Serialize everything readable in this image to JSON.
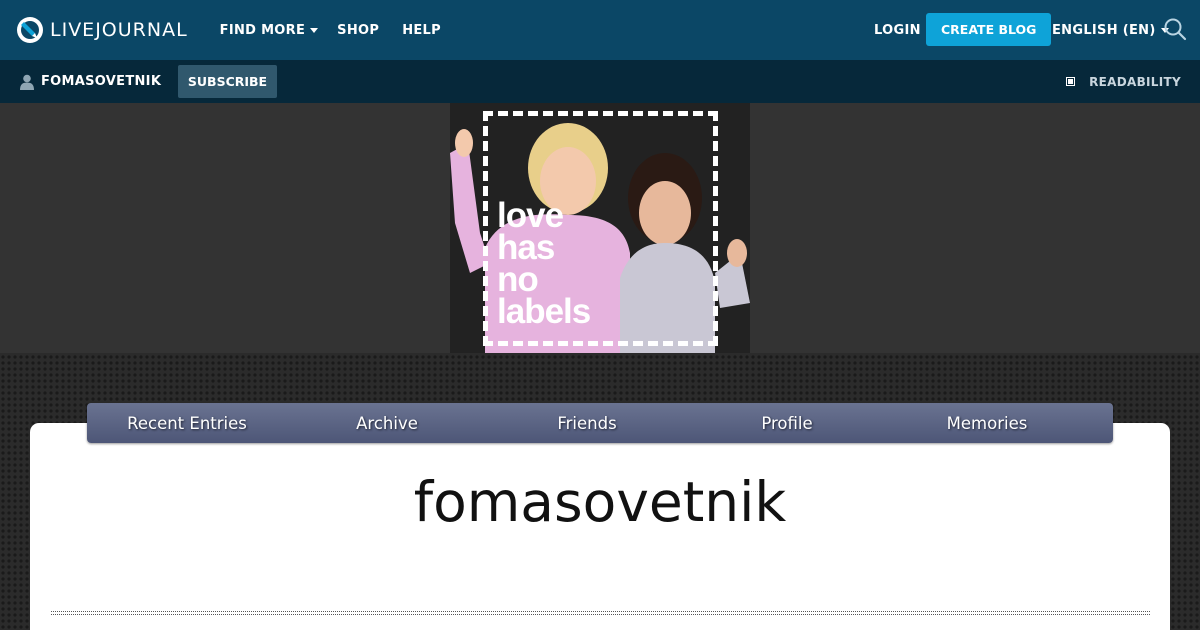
{
  "topbar": {
    "logo_text": "LIVEJOURNAL",
    "nav": [
      {
        "label": "FIND MORE",
        "has_dropdown": true
      },
      {
        "label": "SHOP",
        "has_dropdown": false
      },
      {
        "label": "HELP",
        "has_dropdown": false
      }
    ],
    "login_label": "LOGIN",
    "create_blog_label": "CREATE BLOG",
    "language_label": "ENGLISH (EN)",
    "search_icon": "search-icon"
  },
  "subbar": {
    "username": "FOMASOVETNIK",
    "subscribe_label": "SUBSCRIBE",
    "readability_label": "READABILITY"
  },
  "banner": {
    "text_lines": [
      "love",
      "has",
      "no",
      "labels"
    ]
  },
  "tabs": [
    {
      "label": "Recent Entries"
    },
    {
      "label": "Archive"
    },
    {
      "label": "Friends"
    },
    {
      "label": "Profile"
    },
    {
      "label": "Memories"
    }
  ],
  "journal": {
    "title": "fomasovetnik"
  },
  "colors": {
    "topbar_bg": "#0b4766",
    "subbar_bg": "#06283a",
    "accent": "#0ea3d8",
    "tabs_bg": "#5a6384"
  }
}
